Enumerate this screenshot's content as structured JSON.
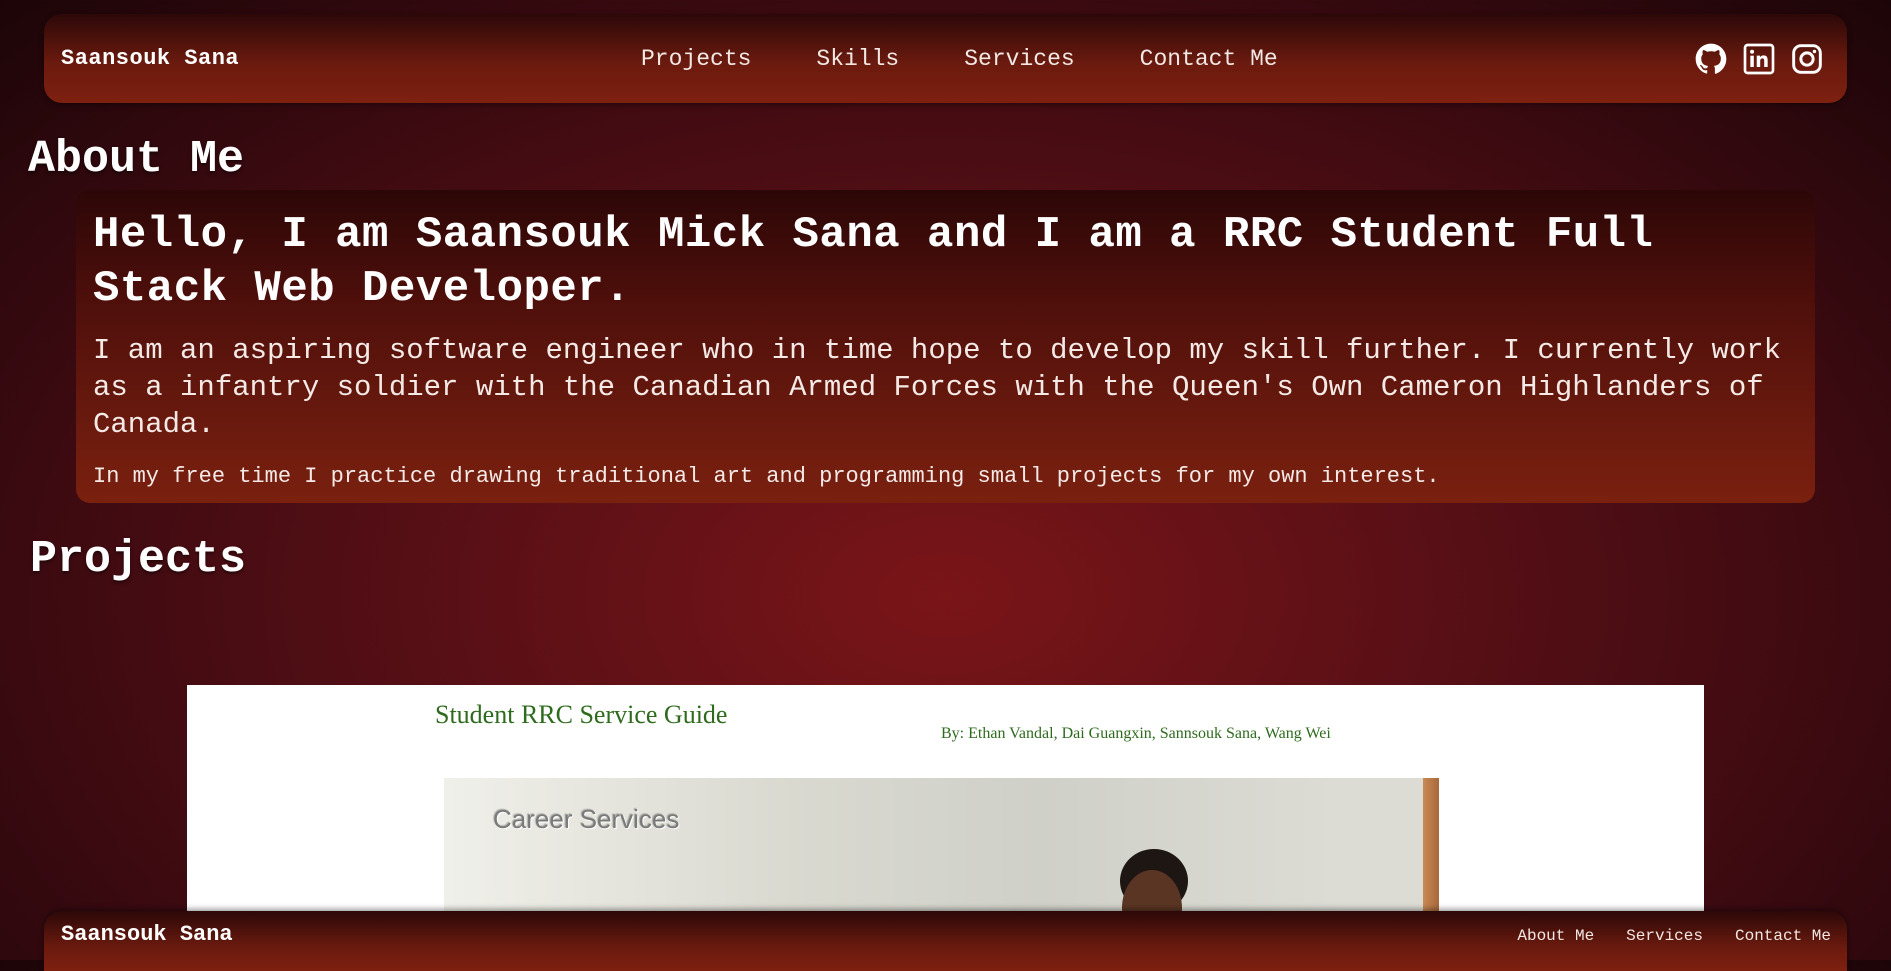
{
  "navbar": {
    "brand": "Saansouk Sana",
    "links": [
      "Projects",
      "Skills",
      "Services",
      "Contact Me"
    ],
    "social_icons": [
      "github-icon",
      "linkedin-icon",
      "instagram-icon"
    ]
  },
  "about": {
    "heading": "About Me",
    "title": "Hello, I am Saansouk Mick Sana and I am a RRC Student Full Stack Web Developer.",
    "paragraph": "I am an aspiring software engineer who in time hope to develop my skill further. I currently work as a infantry soldier with the Canadian Armed Forces with the Queen's Own Cameron Highlanders of Canada.",
    "small": "In my free time I practice drawing traditional art and programming small projects for my own interest."
  },
  "projects": {
    "heading": "Projects",
    "preview": {
      "title": "Student RRC Service Guide",
      "authors": "By: Ethan Vandal, Dai Guangxin, Sannsouk Sana, Wang Wei",
      "image_label": "Career Services"
    }
  },
  "footer": {
    "brand": "Saansouk Sana",
    "links": [
      "About Me",
      "Services",
      "Contact Me"
    ]
  },
  "colors": {
    "background": "#5a1016",
    "navbar": "#6a1a0e",
    "project_title": "#2f6b1e"
  }
}
